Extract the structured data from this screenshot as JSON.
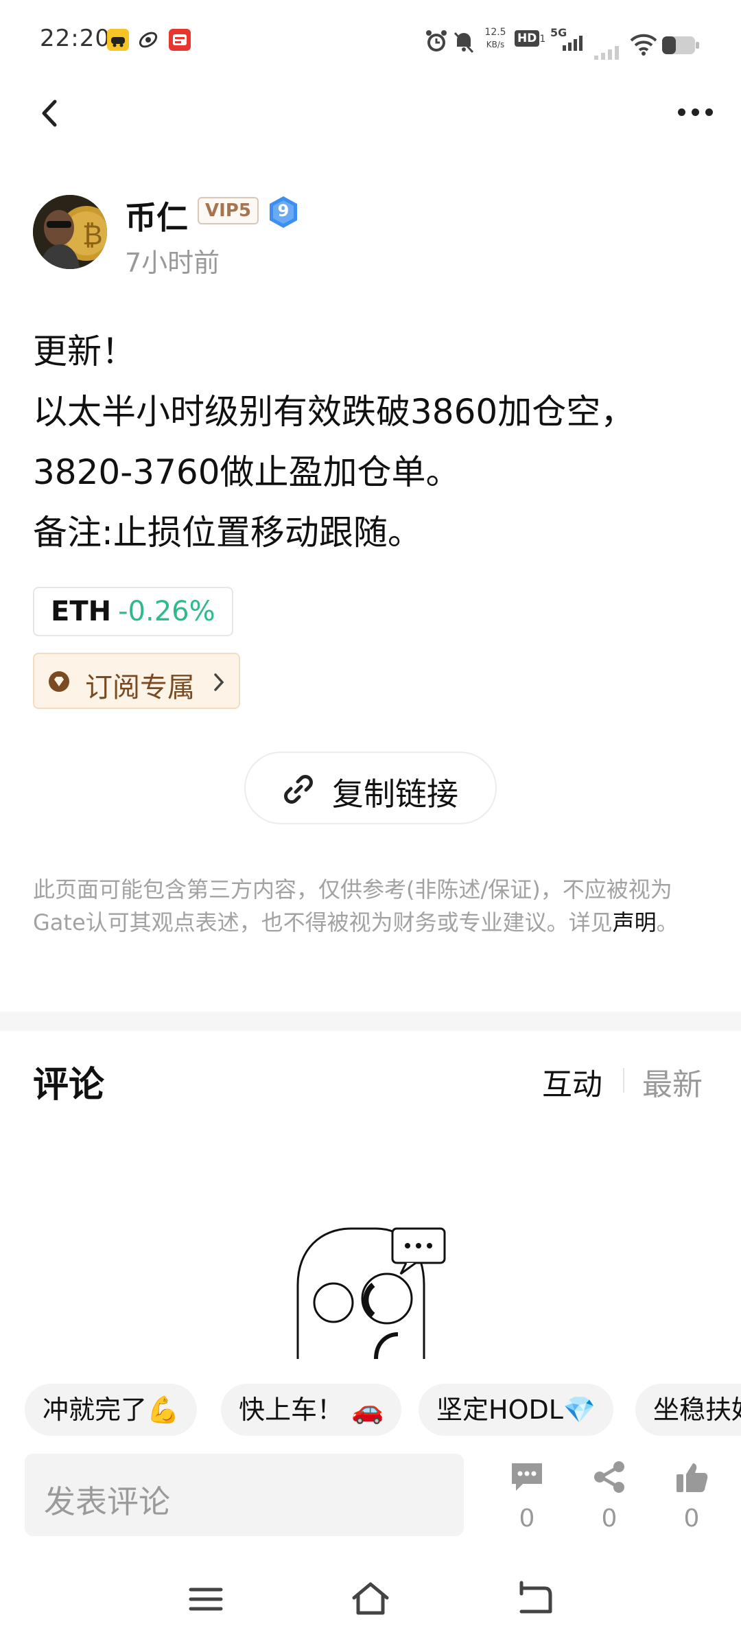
{
  "status_bar": {
    "time": "22:20",
    "net_speed_value": "12.5",
    "net_speed_unit": "KB/s",
    "hd_label": "HD",
    "hd_sub": "1",
    "network": "5G",
    "icons": [
      "app-icon-yellow",
      "app-icon-swirl",
      "app-icon-red",
      "alarm-icon",
      "mute-bell-icon",
      "signal-icon",
      "wifi-icon",
      "battery-icon"
    ]
  },
  "nav": {
    "back_icon": "chevron-left-icon",
    "more_icon": "more-dots-icon"
  },
  "author": {
    "name": "币仁",
    "vip_badge": "VIP5",
    "level": "9",
    "posted": "7小时前"
  },
  "post": {
    "lines": [
      "更新！",
      "以太半小时级别有效跌破3860加仓空，",
      "3820-3760做止盈加仓单。",
      "备注:止损位置移动跟随。"
    ],
    "ticker": {
      "symbol": "ETH",
      "change": "-0.26%",
      "change_color": "#2fba8a"
    },
    "subscription_tag": "订阅专属",
    "copy_link_label": "复制链接"
  },
  "disclaimer": {
    "text": "此页面可能包含第三方内容，仅供参考(非陈述/保证)，不应被视为Gate认可其观点表述，也不得被视为财务或专业建议。详见",
    "link": "声明",
    "end": "。"
  },
  "comments": {
    "title": "评论",
    "sort_interactive": "互动",
    "sort_latest": "最新"
  },
  "quick_replies": [
    "冲就完了💪",
    "快上车！ 🚗",
    "坚定HODL💎",
    "坐稳扶好"
  ],
  "comment_bar": {
    "placeholder": "发表评论",
    "comment_count": "0",
    "share_count": "0",
    "like_count": "0"
  },
  "system_nav": {
    "icons": [
      "menu-icon",
      "home-icon",
      "back-icon"
    ]
  },
  "colors": {
    "accent_green": "#2fba8a",
    "vip_brown": "#a77450",
    "level_blue": "#3c8ef0"
  }
}
